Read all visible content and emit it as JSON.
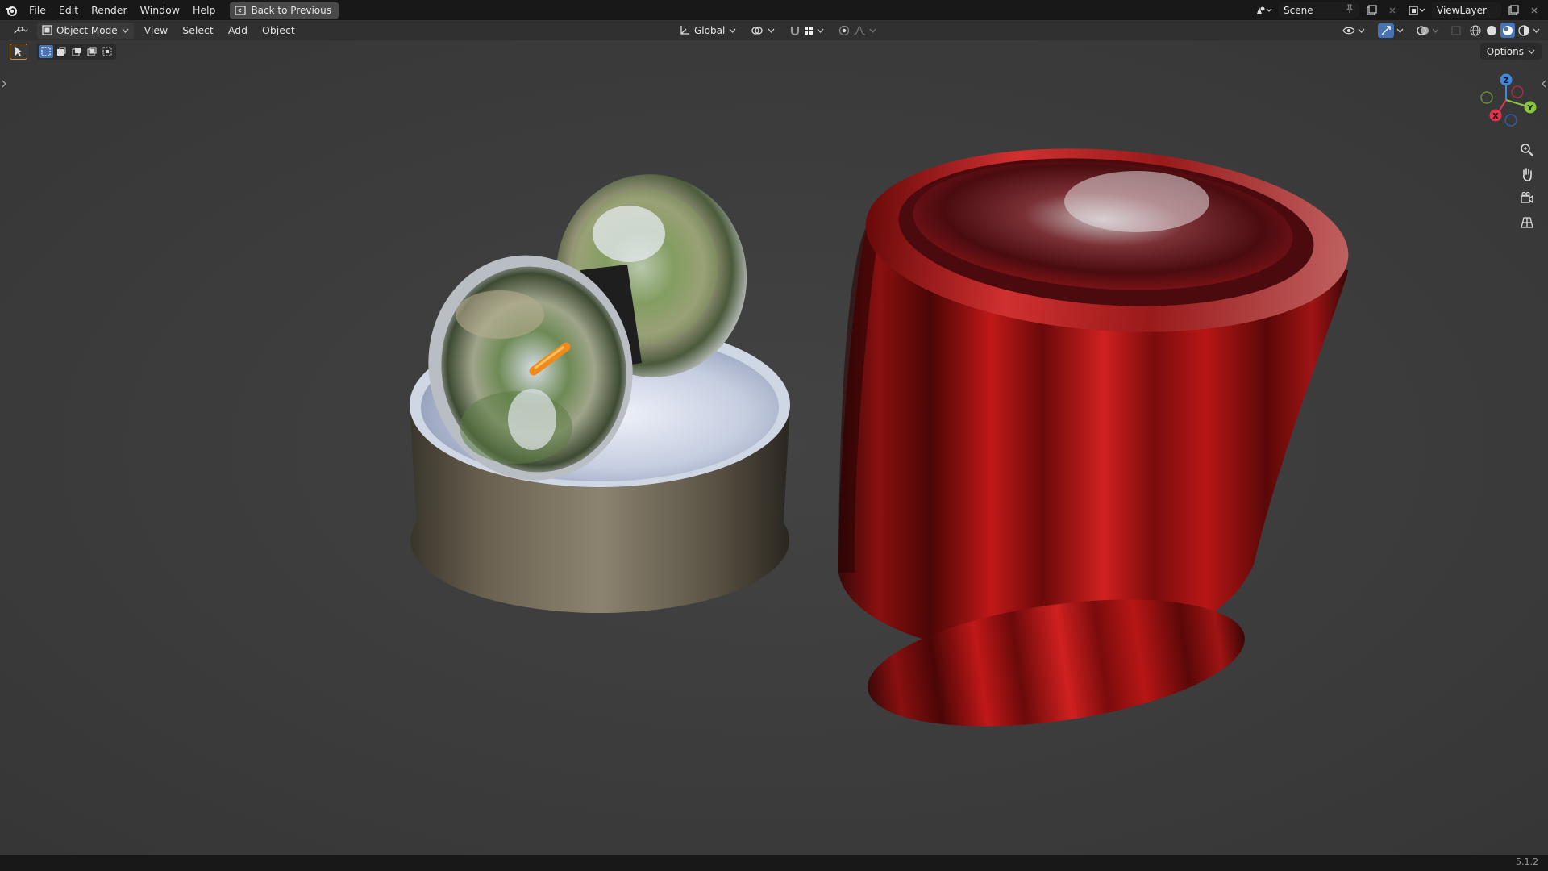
{
  "topbar": {
    "menus": [
      "File",
      "Edit",
      "Render",
      "Window",
      "Help"
    ],
    "back_label": "Back to Previous",
    "scene_label": "Scene",
    "viewlayer_label": "ViewLayer"
  },
  "header": {
    "mode_label": "Object Mode",
    "menus": [
      "View",
      "Select",
      "Add",
      "Object"
    ],
    "orientation_label": "Global"
  },
  "viewport": {
    "options_label": "Options",
    "gizmo_axes": [
      "X",
      "Y",
      "Z"
    ]
  },
  "status": {
    "version": "5.1.2"
  },
  "colors": {
    "accent": "#4772b3",
    "x_axis": "#e0364f",
    "y_axis": "#8bc53f",
    "z_axis": "#3f8ae0"
  }
}
